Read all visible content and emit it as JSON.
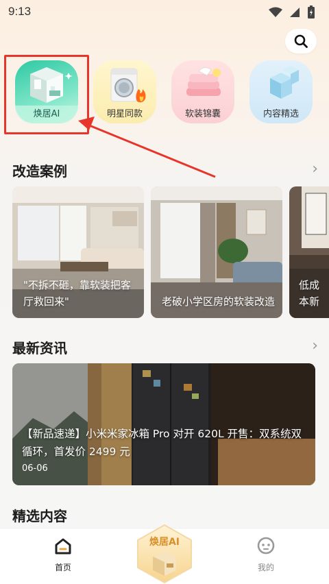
{
  "status_bar": {
    "time": "9:13"
  },
  "quick_entries": [
    {
      "label": "焕居AI",
      "icon": "room-3d-icon",
      "active": true
    },
    {
      "label": "明星同款",
      "icon": "washing-machine-icon",
      "active": false
    },
    {
      "label": "软装锦囊",
      "icon": "towels-icon",
      "active": false
    },
    {
      "label": "内容精选",
      "icon": "cubes-icon",
      "active": false
    }
  ],
  "cases": {
    "title": "改造案例",
    "items": [
      {
        "caption": "\"不拆不砸，靠软装把客厅救回来\""
      },
      {
        "caption": "老破小学区房的软装改造"
      },
      {
        "caption": "低成本新"
      }
    ]
  },
  "news": {
    "title": "最新资讯",
    "headline": "【新品速递】小米米家冰箱 Pro 对开 620L 开售：双系统双循环，首发价 2499 元",
    "date": "06-06"
  },
  "featured": {
    "title": "精选内容"
  },
  "bottom_nav": {
    "home_label": "首页",
    "center_label": "焕居AI",
    "me_label": "我的"
  },
  "colors": {
    "highlight": "#e8352b",
    "accent_teal": "#2fc9a4",
    "center_gold": "#e8a93c"
  }
}
